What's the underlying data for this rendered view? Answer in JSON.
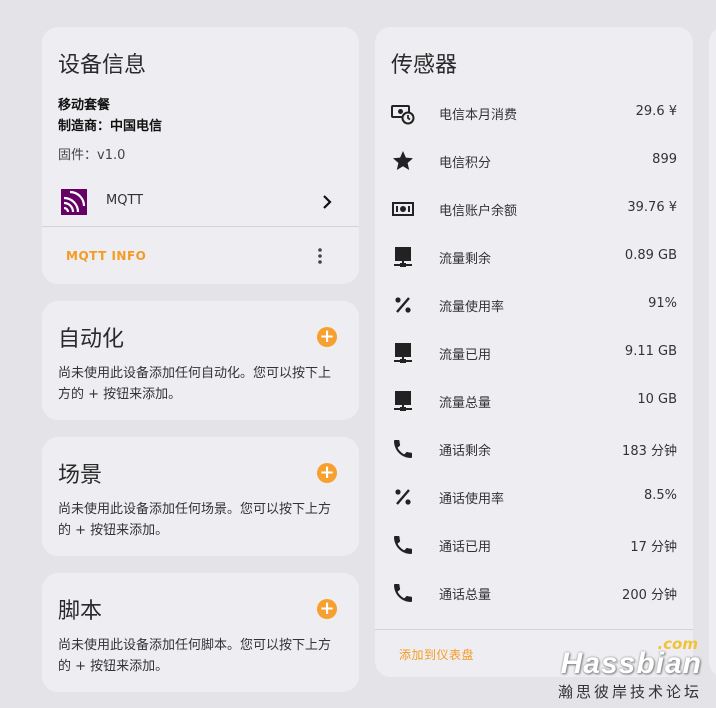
{
  "device_info": {
    "title": "设备信息",
    "model": "移动套餐",
    "manufacturer_label": "制造商：中国电信",
    "firmware_label": "固件：v1.0",
    "integration_name": "MQTT",
    "info_link": "MQTT INFO"
  },
  "automation": {
    "title": "自动化",
    "description": "尚未使用此设备添加任何自动化。您可以按下上方的 + 按钮来添加。"
  },
  "scene": {
    "title": "场景",
    "description": "尚未使用此设备添加任何场景。您可以按下上方的 + 按钮来添加。"
  },
  "script": {
    "title": "脚本",
    "description": "尚未使用此设备添加任何脚本。您可以按下上方的 + 按钮来添加。"
  },
  "sensors": {
    "title": "传感器",
    "items": [
      {
        "name": "电信本月消费",
        "value": "29.6 ¥",
        "icon": "cash-clock-icon"
      },
      {
        "name": "电信积分",
        "value": "899",
        "icon": "star-icon"
      },
      {
        "name": "电信账户余额",
        "value": "39.76 ¥",
        "icon": "cash-icon"
      },
      {
        "name": "流量剩余",
        "value": "0.89 GB",
        "icon": "network-icon"
      },
      {
        "name": "流量使用率",
        "value": "91%",
        "icon": "percent-icon"
      },
      {
        "name": "流量已用",
        "value": "9.11 GB",
        "icon": "network-icon"
      },
      {
        "name": "流量总量",
        "value": "10 GB",
        "icon": "network-icon"
      },
      {
        "name": "通话剩余",
        "value": "183 分钟",
        "icon": "phone-icon"
      },
      {
        "name": "通话使用率",
        "value": "8.5%",
        "icon": "percent-icon"
      },
      {
        "name": "通话已用",
        "value": "17 分钟",
        "icon": "phone-icon"
      },
      {
        "name": "通话总量",
        "value": "200 分钟",
        "icon": "phone-icon"
      }
    ],
    "add_to_dashboard": "添加到仪表盘"
  },
  "watermark": {
    "com": ".com",
    "brand": "Hassbian",
    "subtitle": "瀚思彼岸技术论坛"
  },
  "colors": {
    "accent": "#f59b23",
    "mqtt_icon": "#660066",
    "background": "#e3e3e8",
    "card": "#eeeef2"
  }
}
